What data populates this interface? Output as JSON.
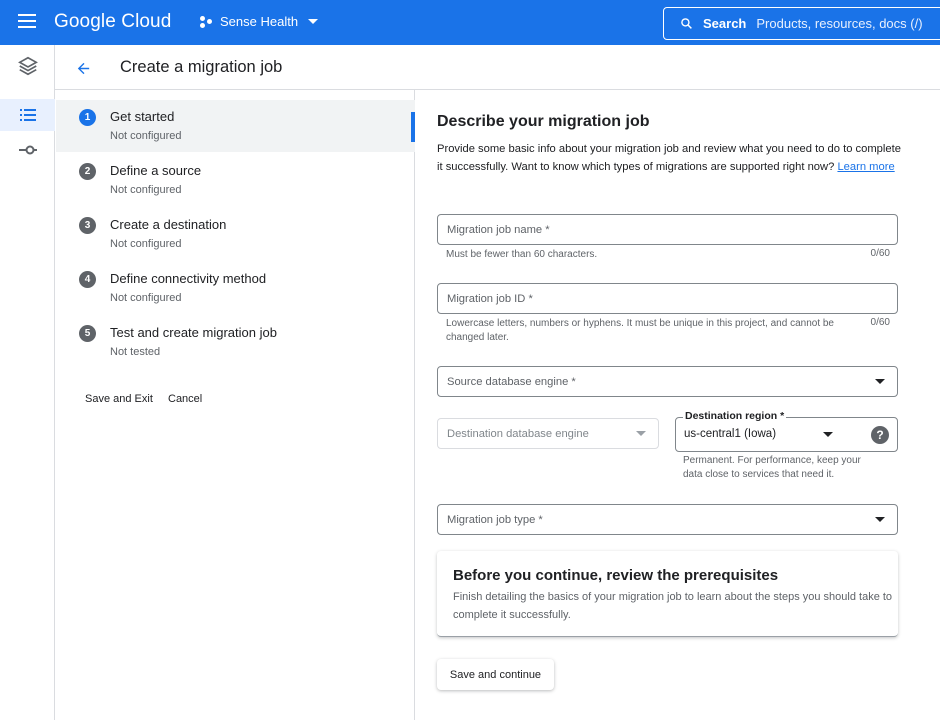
{
  "topbar": {
    "logo": "Google Cloud",
    "project": "Sense Health",
    "search_label": "Search",
    "search_placeholder": "Products, resources, docs (/)"
  },
  "header": {
    "title": "Create a migration job"
  },
  "stepper": {
    "steps": [
      {
        "num": "1",
        "title": "Get started",
        "status": "Not configured",
        "active": true
      },
      {
        "num": "2",
        "title": "Define a source",
        "status": "Not configured"
      },
      {
        "num": "3",
        "title": "Create a destination",
        "status": "Not configured"
      },
      {
        "num": "4",
        "title": "Define connectivity method",
        "status": "Not configured"
      },
      {
        "num": "5",
        "title": "Test and create migration job",
        "status": "Not tested"
      }
    ],
    "save_exit": "Save and Exit",
    "cancel": "Cancel"
  },
  "form": {
    "heading": "Describe your migration job",
    "intro": "Provide some basic info about your migration job and review what you need to do to complete it successfully. Want to know which types of migrations are supported right now?",
    "learn_more": "Learn more",
    "job_name": {
      "placeholder": "Migration job name *",
      "hint": "Must be fewer than 60 characters.",
      "counter": "0/60"
    },
    "job_id": {
      "placeholder": "Migration job ID *",
      "hint": "Lowercase letters, numbers or hyphens. It must be unique in this project, and cannot be changed later.",
      "counter": "0/60"
    },
    "source_engine": {
      "placeholder": "Source database engine *"
    },
    "dest_engine": {
      "placeholder": "Destination database engine"
    },
    "dest_region": {
      "label": "Destination region *",
      "value": "us-central1 (Iowa)",
      "hint": "Permanent. For performance, keep your data close to services that need it."
    },
    "job_type": {
      "placeholder": "Migration job type *"
    },
    "prereq": {
      "title": "Before you continue, review the prerequisites",
      "body": "Finish detailing the basics of your migration job to learn about the steps you should take to complete it successfully."
    },
    "save_continue": "Save and continue"
  },
  "colors": {
    "accent": "#1a73e8",
    "active_step_bg": "#f1f3f4",
    "border": "#dadce0"
  },
  "icons": [
    "menu-icon",
    "project-icon",
    "search-icon",
    "layers-icon",
    "list-icon",
    "connection-icon",
    "back-arrow-icon",
    "help-icon"
  ]
}
